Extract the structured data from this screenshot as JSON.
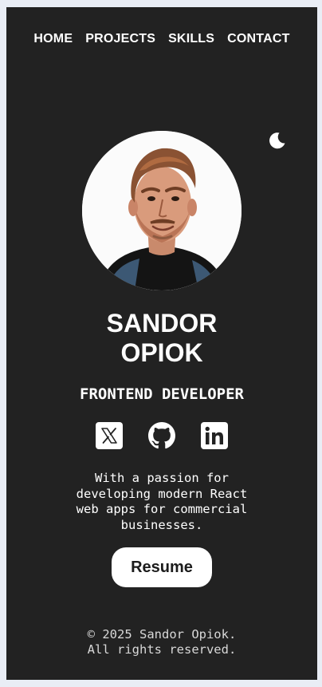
{
  "nav": {
    "items": [
      {
        "label": "HOME"
      },
      {
        "label": "PROJECTS"
      },
      {
        "label": "SKILLS"
      },
      {
        "label": "CONTACT"
      }
    ]
  },
  "theme_toggle": {
    "icon": "moon-icon"
  },
  "profile": {
    "name_line1": "SANDOR",
    "name_line2": "OPIOK",
    "role": "FRONTEND DEVELOPER",
    "tagline": "With a passion for developing modern React web apps for commercial businesses."
  },
  "socials": [
    {
      "icon": "x-twitter-icon"
    },
    {
      "icon": "github-icon"
    },
    {
      "icon": "linkedin-icon"
    }
  ],
  "resume_button": {
    "label": "Resume"
  },
  "footer": {
    "line1": "© 2025 Sandor Opiok.",
    "line2": "All rights reserved."
  },
  "colors": {
    "page_background": "#222222",
    "outer_background": "#e9edf5",
    "text": "#ffffff",
    "button_background": "#ffffff",
    "button_text": "#1c1c1c"
  }
}
